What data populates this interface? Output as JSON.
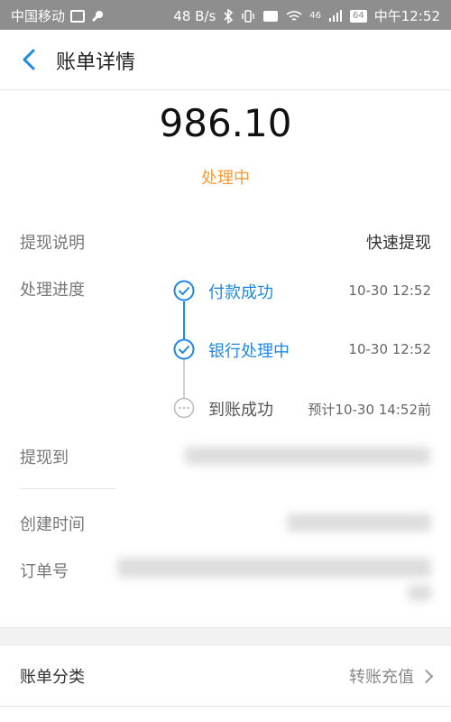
{
  "status_bar": {
    "carrier": "中国移动",
    "speed": "48 B/s",
    "network": "46",
    "battery": "64",
    "time": "中午12:52"
  },
  "nav": {
    "title": "账单详情"
  },
  "summary": {
    "amount": "986.10",
    "status": "处理中"
  },
  "details": {
    "withdraw_desc_label": "提现说明",
    "withdraw_desc_value": "快速提现",
    "progress_label": "处理进度",
    "steps": [
      {
        "label": "付款成功",
        "time": "10-30 12:52"
      },
      {
        "label": "银行处理中",
        "time": "10-30 12:52"
      },
      {
        "label": "到账成功",
        "time": "预计10-30 14:52前"
      }
    ],
    "withdraw_to_label": "提现到",
    "created_label": "创建时间",
    "order_label": "订单号"
  },
  "category": {
    "label": "账单分类",
    "value": "转账充值"
  },
  "colors": {
    "accent_blue": "#1e88e5",
    "status_orange": "#f29c38"
  }
}
